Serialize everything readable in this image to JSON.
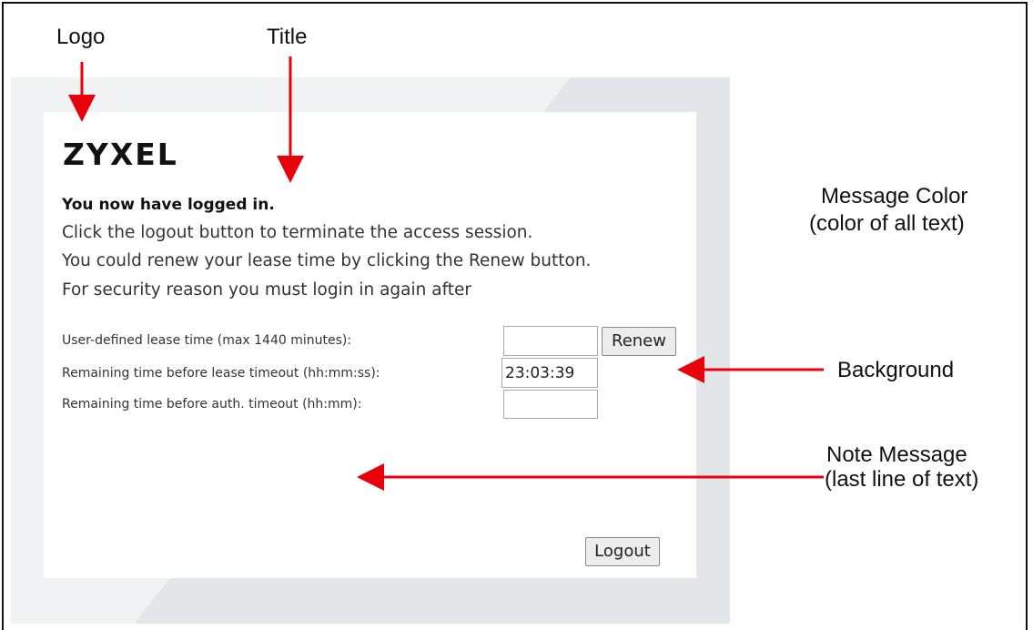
{
  "callouts": {
    "logo": "Logo",
    "title": "Title",
    "message_color_line1": "Message Color",
    "message_color_line2": "(color of all text)",
    "background": "Background",
    "note_line1": "Note Message",
    "note_line2": "(last line of text)"
  },
  "page": {
    "logo_text": "ZYXEL",
    "title": "You now have logged in.",
    "messages": [
      "Click the logout button to terminate the access session.",
      "You could renew your lease time by clicking the Renew button.",
      "For security reason you must login in again after"
    ],
    "fields": {
      "lease_time_label": "User-defined lease time (max 1440 minutes):",
      "lease_time_value": "",
      "remaining_lease_label": "Remaining time before lease timeout (hh:mm:ss):",
      "remaining_lease_value": "23:03:39",
      "remaining_auth_label": "Remaining time before auth. timeout (hh:mm):",
      "remaining_auth_value": ""
    },
    "buttons": {
      "renew": "Renew",
      "logout": "Logout"
    }
  },
  "colors": {
    "arrow": "#e8000b",
    "background_panel": "#e3e6e9",
    "card": "#ffffff"
  }
}
